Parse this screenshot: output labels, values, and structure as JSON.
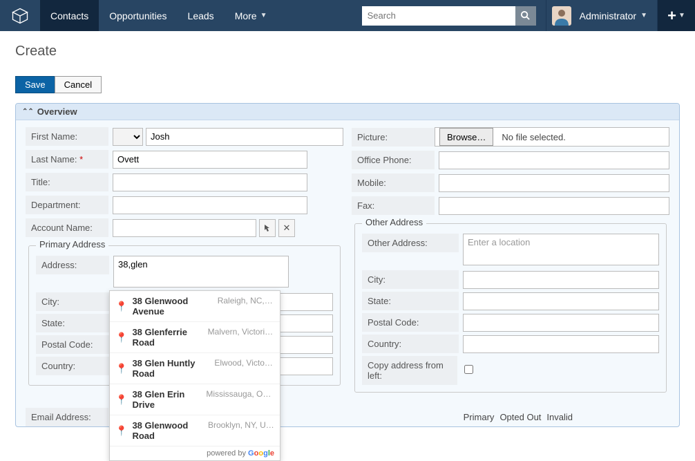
{
  "nav": {
    "items": [
      {
        "label": "Contacts",
        "active": true
      },
      {
        "label": "Opportunities"
      },
      {
        "label": "Leads"
      },
      {
        "label": "More",
        "dropdown": true
      }
    ],
    "search_placeholder": "Search",
    "user": "Administrator"
  },
  "page": {
    "title": "Create",
    "save": "Save",
    "cancel": "Cancel"
  },
  "panel": {
    "title": "Overview"
  },
  "labels": {
    "first_name": "First Name:",
    "last_name": "Last Name:",
    "title": "Title:",
    "department": "Department:",
    "account_name": "Account Name:",
    "picture": "Picture:",
    "browse": "Browse…",
    "no_file": "No file selected.",
    "office_phone": "Office Phone:",
    "mobile": "Mobile:",
    "fax": "Fax:",
    "primary_address": "Primary Address",
    "other_address": "Other Address",
    "address": "Address:",
    "other_address_field": "Other Address:",
    "city": "City:",
    "state": "State:",
    "postal_code": "Postal Code:",
    "country": "Country:",
    "copy_left": "Copy address from left:",
    "other_placeholder": "Enter a location",
    "email_address": "Email Address:",
    "primary": "Primary",
    "opted_out": "Opted Out",
    "invalid": "Invalid"
  },
  "values": {
    "first_name": "Josh",
    "last_name": "Ovett",
    "address": "38,glen"
  },
  "autocomplete": [
    {
      "main": "38 Glenwood Avenue",
      "sub": "Raleigh, NC, U..."
    },
    {
      "main": "38 Glenferrie Road",
      "sub": "Malvern, Victoria, ..."
    },
    {
      "main": "38 Glen Huntly Road",
      "sub": "Elwood, Victoria..."
    },
    {
      "main": "38 Glen Erin Drive",
      "sub": "Mississauga, ON, ..."
    },
    {
      "main": "38 Glenwood Road",
      "sub": "Brooklyn, NY, Unit..."
    }
  ],
  "autocomplete_footer": "powered by"
}
